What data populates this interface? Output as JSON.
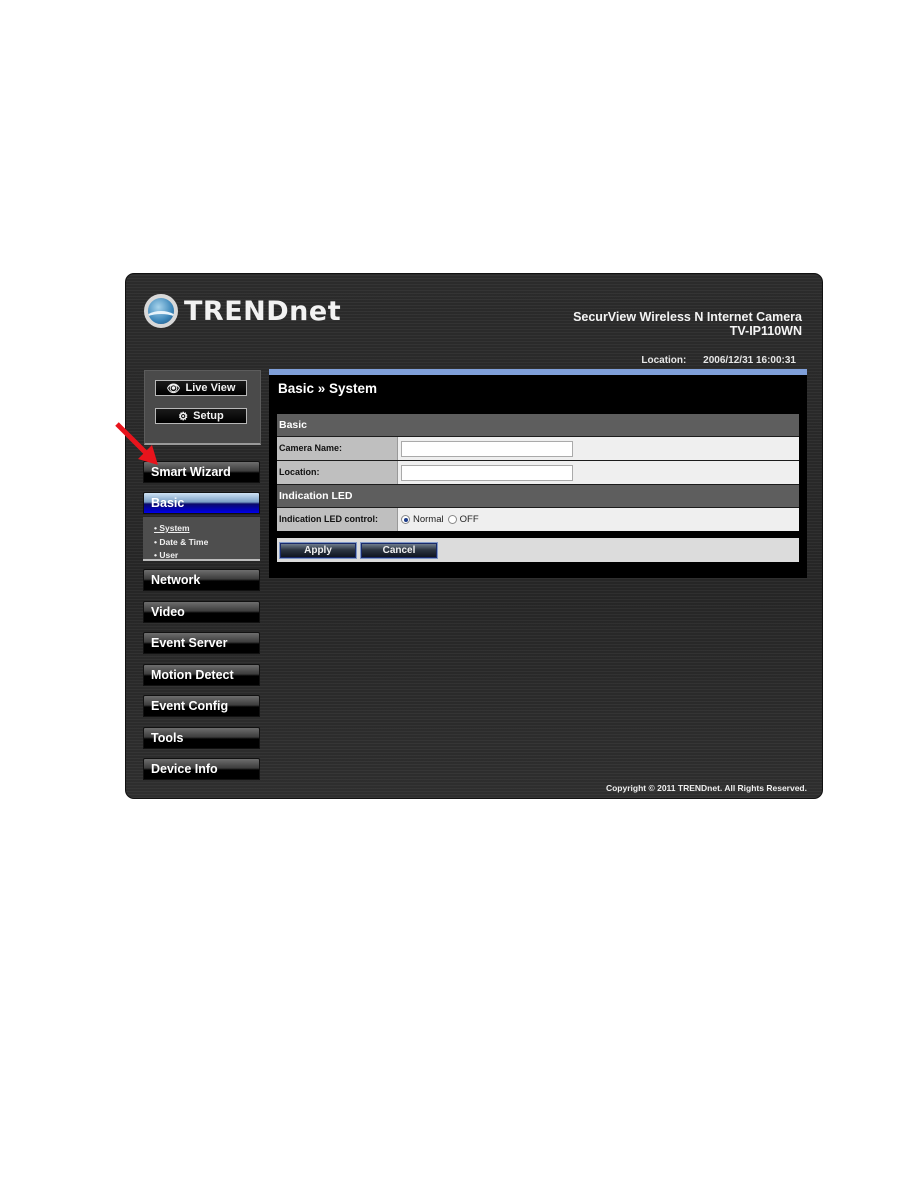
{
  "header": {
    "brand": "TRENDnet",
    "product_name": "SecurView Wireless N Internet Camera",
    "model": "TV-IP110WN",
    "location_label": "Location:",
    "datetime": "2006/12/31 16:00:31"
  },
  "sidebar": {
    "top_buttons": [
      {
        "label": "Live View",
        "icon": "eye-icon"
      },
      {
        "label": "Setup",
        "icon": "gears-icon"
      }
    ],
    "menu": [
      {
        "label": "Smart Wizard"
      },
      {
        "label": "Basic",
        "active": true
      },
      {
        "label": "Network"
      },
      {
        "label": "Video"
      },
      {
        "label": "Event Server"
      },
      {
        "label": "Motion Detect"
      },
      {
        "label": "Event Config"
      },
      {
        "label": "Tools"
      },
      {
        "label": "Device Info"
      }
    ],
    "submenu": [
      {
        "label": "• System",
        "current": true
      },
      {
        "label": "• Date & Time"
      },
      {
        "label": "• User"
      }
    ]
  },
  "content": {
    "title": "Basic » System",
    "sections": {
      "basic": {
        "heading": "Basic",
        "camera_name_label": "Camera Name:",
        "camera_name_value": "",
        "location_label": "Location:",
        "location_value": ""
      },
      "led": {
        "heading": "Indication LED",
        "control_label": "Indication LED control:",
        "options": [
          "Normal",
          "OFF"
        ],
        "selected": "Normal"
      }
    },
    "buttons": {
      "apply": "Apply",
      "cancel": "Cancel"
    }
  },
  "footer": {
    "copyright": "Copyright © 2011 TRENDnet. All Rights Reserved."
  },
  "annotation": {
    "arrow_color": "#e8141c",
    "points_to": "Smart Wizard"
  }
}
